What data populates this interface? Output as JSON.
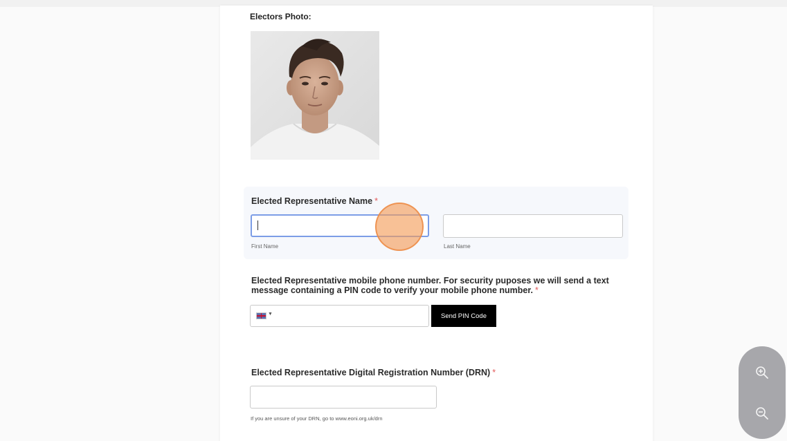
{
  "photo": {
    "label": "Electors Photo:"
  },
  "name_section": {
    "title": "Elected Representative Name",
    "required_mark": "*",
    "first_name": {
      "value": "",
      "sublabel": "First Name"
    },
    "last_name": {
      "value": "",
      "sublabel": "Last Name"
    }
  },
  "phone_section": {
    "title": "Elected Representative mobile phone number. For security puposes we will send a text message containing a PIN code to verify your mobile phone number.",
    "required_mark": "*",
    "country_flag": "uk-flag-icon",
    "phone_value": "",
    "send_pin_label": "Send PIN Code"
  },
  "drn_section": {
    "title": "Elected Representative Digital Registration Number (DRN)",
    "required_mark": "*",
    "value": "",
    "helper": "If you are unsure of your DRN, go to www.eoni.org.uk/drn"
  },
  "zoom": {
    "zoom_in_icon": "zoom-in-icon",
    "zoom_out_icon": "zoom-out-icon"
  },
  "colors": {
    "focus_border": "#7c9de6",
    "required": "#e35b5b",
    "click_highlight": "#f39b55",
    "button_bg": "#000000",
    "zoom_panel": "#a7a7ab"
  }
}
